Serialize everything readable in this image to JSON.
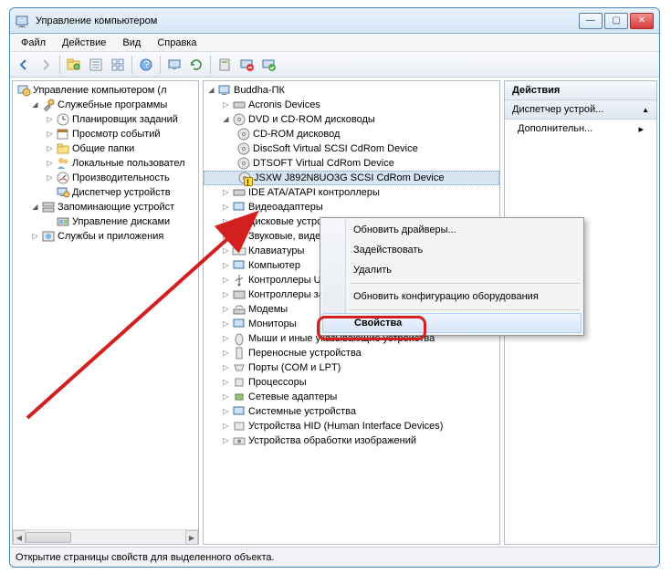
{
  "window": {
    "title": "Управление компьютером"
  },
  "menu": {
    "file": "Файл",
    "action": "Действие",
    "view": "Вид",
    "help": "Справка"
  },
  "left_tree": {
    "root": "Управление компьютером (л",
    "sys_tools": "Служебные программы",
    "scheduler": "Планировщик заданий",
    "eventvwr": "Просмотр событий",
    "shared": "Общие папки",
    "users": "Локальные пользовател",
    "perf": "Производительность",
    "devmgr": "Диспетчер устройств",
    "storage": "Запоминающие устройст",
    "diskmgr": "Управление дисками",
    "services": "Службы и приложения"
  },
  "center_tree": {
    "root": "Buddha-ПК",
    "acronis": "Acronis Devices",
    "dvd": "DVD и CD-ROM дисководы",
    "cdrom": "CD-ROM дисковод",
    "discsoft": "DiscSoft Virtual SCSI CdRom Device",
    "dtsoft": "DTSOFT Virtual CdRom Device",
    "jsxw": "JSXW J892N8UO3G SCSI CdRom Device",
    "ide": "IDE ATA/ATAPI контроллеры",
    "video": "Видеоадаптеры",
    "disk": "Дисковые устройства",
    "sound": "Звуковые, видео и игровые устройства",
    "keyboard": "Клавиатуры",
    "computer": "Компьютер",
    "usb": "Контроллеры USB",
    "storage_ctrl": "Контроллеры запоминающих устройств",
    "modems": "Модемы",
    "monitors": "Мониторы",
    "mice": "Мыши и иные указывающие устройства",
    "portable": "Переносные устройства",
    "ports": "Порты (COM и LPT)",
    "cpus": "Процессоры",
    "net": "Сетевые адаптеры",
    "sysdev": "Системные устройства",
    "hid": "Устройства HID (Human Interface Devices)",
    "imaging": "Устройства обработки изображений"
  },
  "context_menu": {
    "update_drivers": "Обновить драйверы...",
    "enable": "Задействовать",
    "delete": "Удалить",
    "scan": "Обновить конфигурацию оборудования",
    "properties": "Свойства"
  },
  "actions": {
    "header": "Действия",
    "sub": "Диспетчер устрой...",
    "more": "Дополнительн..."
  },
  "status": "Открытие страницы свойств для выделенного объекта."
}
